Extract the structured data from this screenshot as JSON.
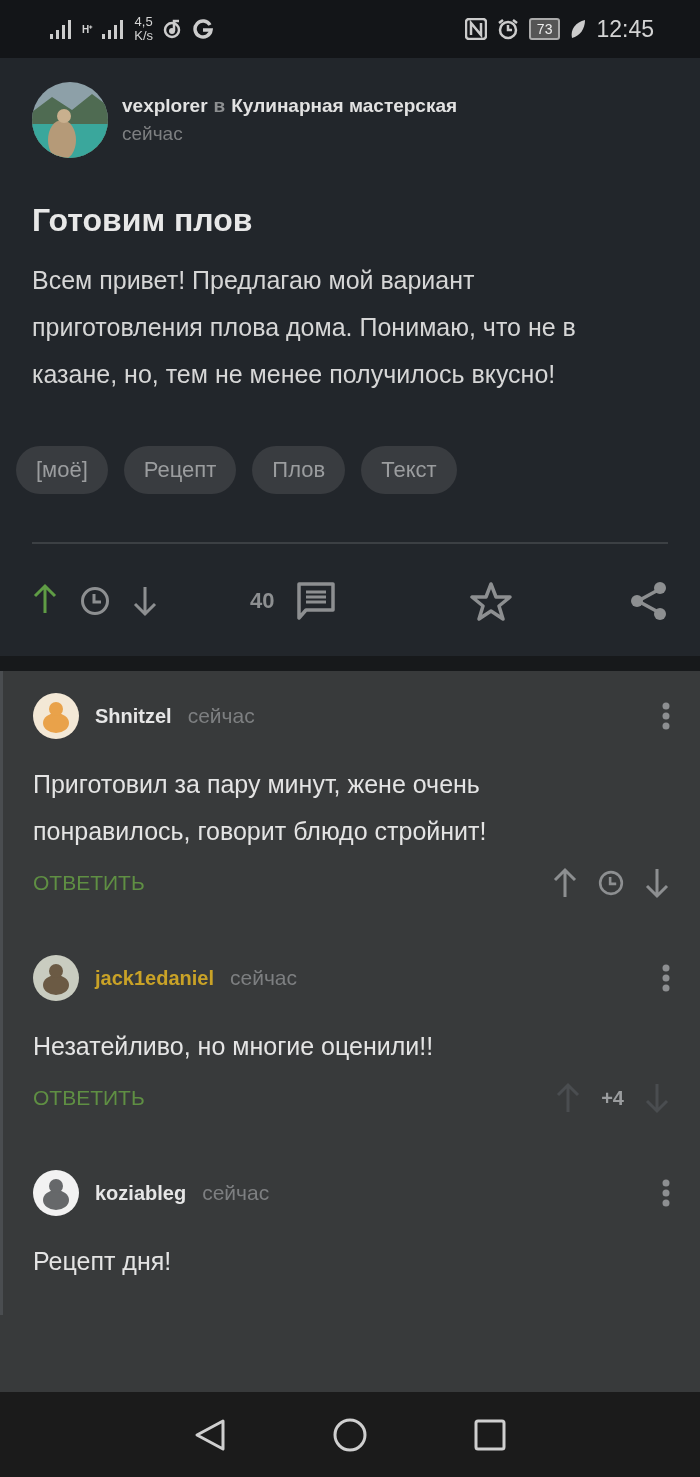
{
  "status_bar": {
    "network_type": "H⁺",
    "speed": "4,5",
    "speed_unit": "K/s",
    "battery": "73",
    "time": "12:45"
  },
  "post": {
    "author": "vexplorer",
    "in": "в",
    "community": "Кулинарная мастерская",
    "time": "сейчас",
    "title": "Готовим плов",
    "body": "Всем привет! Предлагаю мой вариант приготовления плова дома. Понимаю, что не в казане, но, тем не менее получилось вкусно!",
    "tags": [
      "[моё]",
      "Рецепт",
      "Плов",
      "Текст"
    ],
    "upvoted": true,
    "comment_count": "40"
  },
  "comments": [
    {
      "author": "Shnitzel",
      "color": "#e6e6e6",
      "time": "сейчас",
      "text": "Приготовил за пару минут, жене очень понравилось, говорит блюдо стройнит!",
      "reply": "ОТВЕТИТЬ",
      "rating": {
        "kind": "hidden"
      }
    },
    {
      "author": "jack1edaniel",
      "color": "#c9a227",
      "time": "сейчас",
      "text": "Незатейливо, но многие оценили!!",
      "reply": "ОТВЕТИТЬ",
      "rating": {
        "kind": "score",
        "score": "+4"
      }
    },
    {
      "author": "koziableg",
      "color": "#e6e6e6",
      "time": "сейчас",
      "text": "Рецепт дня!"
    }
  ]
}
